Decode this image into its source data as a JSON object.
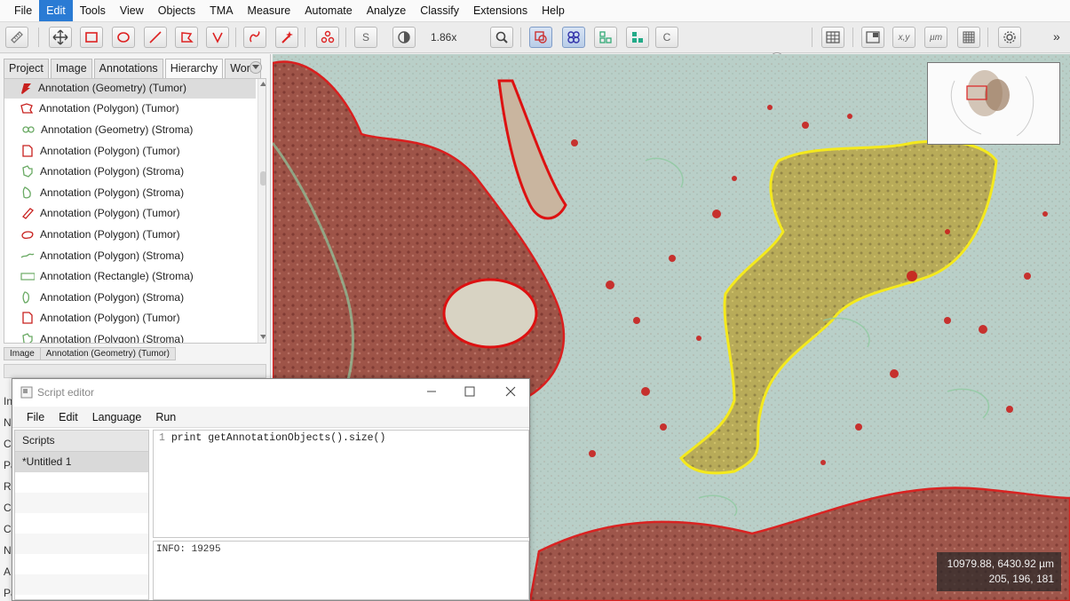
{
  "menubar": {
    "items": [
      "File",
      "Edit",
      "Tools",
      "View",
      "Objects",
      "TMA",
      "Measure",
      "Automate",
      "Analyze",
      "Classify",
      "Extensions",
      "Help"
    ],
    "active_index": 1
  },
  "toolbar": {
    "zoom": "1.86x",
    "slider_value": 0.77,
    "expand_label": "»",
    "text_buttons": {
      "s": "S",
      "c": "C",
      "xy": "x,y",
      "um": "µm"
    }
  },
  "left_panel": {
    "tabs": [
      "Project",
      "Image",
      "Annotations",
      "Hierarchy",
      "Work"
    ],
    "active_tab": "Hierarchy",
    "hierarchy": [
      {
        "label": "Annotation (Geometry) (Tumor)",
        "class": "Tumor",
        "selected": true
      },
      {
        "label": "Annotation (Polygon) (Tumor)",
        "class": "Tumor"
      },
      {
        "label": "Annotation (Geometry) (Stroma)",
        "class": "Stroma"
      },
      {
        "label": "Annotation (Polygon) (Tumor)",
        "class": "Tumor"
      },
      {
        "label": "Annotation (Polygon) (Stroma)",
        "class": "Stroma"
      },
      {
        "label": "Annotation (Polygon) (Stroma)",
        "class": "Stroma"
      },
      {
        "label": "Annotation (Polygon) (Tumor)",
        "class": "Tumor"
      },
      {
        "label": "Annotation (Polygon) (Tumor)",
        "class": "Tumor"
      },
      {
        "label": "Annotation (Polygon) (Stroma)",
        "class": "Stroma"
      },
      {
        "label": "Annotation (Rectangle) (Stroma)",
        "class": "Stroma"
      },
      {
        "label": "Annotation (Polygon) (Stroma)",
        "class": "Stroma"
      },
      {
        "label": "Annotation (Polygon) (Tumor)",
        "class": "Tumor"
      },
      {
        "label": "Annotation (Polygon) (Stroma)",
        "class": "Stroma"
      }
    ],
    "breadcrumb": [
      "Image",
      "Annotation (Geometry) (Tumor)"
    ],
    "side_letters": [
      "In",
      "N",
      "C",
      "Pa",
      "R",
      "C",
      "C",
      "N",
      "A",
      "Pa"
    ]
  },
  "viewer": {
    "coords_um": "10979.88, 6430.92 µm",
    "pixel_rgb": "205, 196, 181"
  },
  "script_editor": {
    "title": "Script editor",
    "menu": [
      "File",
      "Edit",
      "Language",
      "Run"
    ],
    "scripts_header": "Scripts",
    "scripts": [
      "*Untitled 1"
    ],
    "code_line_number": "1",
    "code": "print getAnnotationObjects().size()",
    "output": "INFO: 19295"
  },
  "colors": {
    "tumor": "#c8201e",
    "stroma": "#6aaa64",
    "selection": "#ffee00",
    "accent": "#2a7bd4"
  }
}
